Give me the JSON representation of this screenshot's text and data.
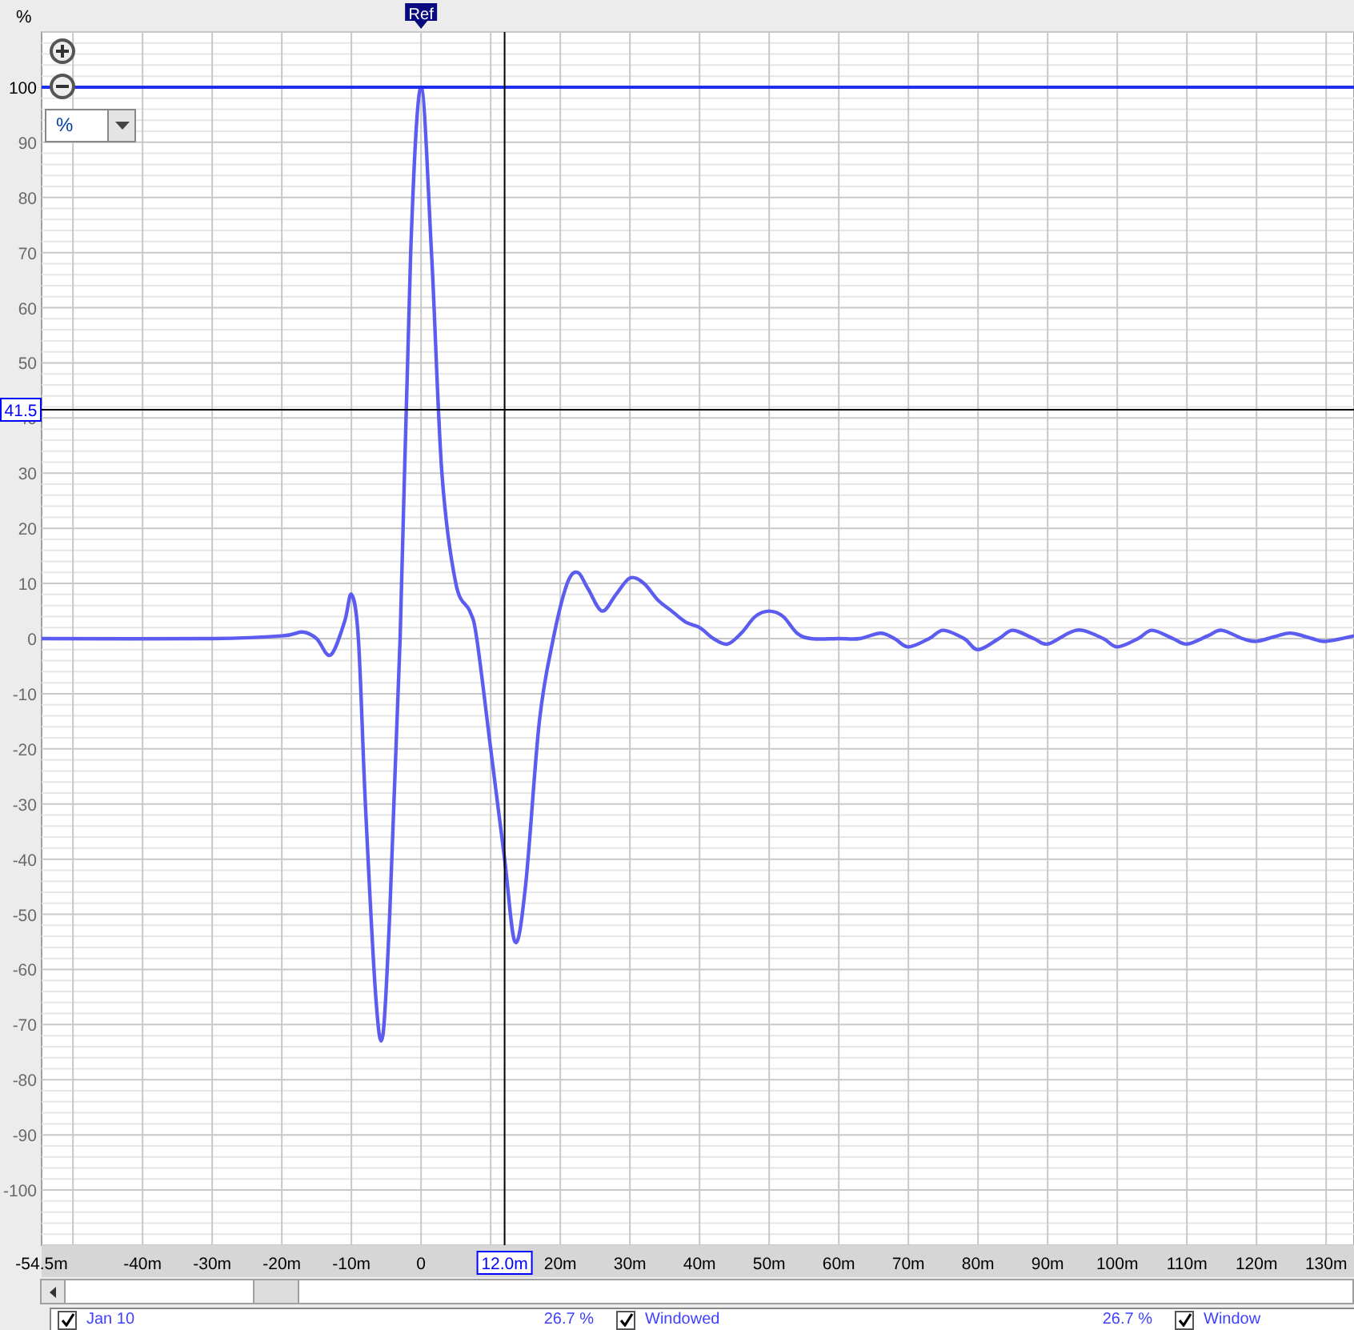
{
  "chart": {
    "units_select": {
      "value": "%"
    },
    "chart_data": {
      "type": "line",
      "ylabel": "%",
      "xlim": [
        -54.5,
        134
      ],
      "ylim": [
        -110,
        110
      ],
      "xticks": [
        {
          "value": -54.5,
          "label": "-54.5m"
        },
        {
          "value": -40,
          "label": "-40m"
        },
        {
          "value": -30,
          "label": "-30m"
        },
        {
          "value": -20,
          "label": "-20m"
        },
        {
          "value": -10,
          "label": "-10m"
        },
        {
          "value": 0,
          "label": "0"
        },
        {
          "value": 20,
          "label": "20m"
        },
        {
          "value": 30,
          "label": "30m"
        },
        {
          "value": 40,
          "label": "40m"
        },
        {
          "value": 50,
          "label": "50m"
        },
        {
          "value": 60,
          "label": "60m"
        },
        {
          "value": 70,
          "label": "70m"
        },
        {
          "value": 80,
          "label": "80m"
        },
        {
          "value": 90,
          "label": "90m"
        },
        {
          "value": 100,
          "label": "100m"
        },
        {
          "value": 110,
          "label": "110m"
        },
        {
          "value": 120,
          "label": "120m"
        },
        {
          "value": 130,
          "label": "130m"
        }
      ],
      "yticks": [
        100,
        90,
        80,
        70,
        60,
        50,
        40,
        30,
        20,
        10,
        0,
        -10,
        -20,
        -30,
        -40,
        -50,
        -60,
        -70,
        -80,
        -90,
        -100
      ],
      "x": [
        -54.5,
        -30,
        -20,
        -17,
        -15,
        -13,
        -11,
        -10,
        -9,
        -8,
        -6.5,
        -5.5,
        -4.5,
        -3,
        -1.5,
        0,
        1.5,
        3,
        5,
        7,
        8,
        10,
        12,
        13.5,
        15,
        17,
        19,
        21,
        22.5,
        24,
        26,
        28,
        30,
        32,
        34,
        36,
        38,
        40,
        42,
        44,
        46,
        48,
        50,
        52,
        54,
        56,
        60,
        63,
        66,
        68,
        70,
        73,
        75,
        78,
        80,
        83,
        85,
        88,
        90,
        93,
        95,
        98,
        100,
        103,
        105,
        108,
        110,
        113,
        115,
        118,
        120,
        123,
        125,
        128,
        130,
        134
      ],
      "series": [
        {
          "color": "#5c5cf0",
          "values": [
            0,
            0,
            0.5,
            1.2,
            0,
            -3,
            3,
            8,
            0,
            -30,
            -65,
            -72,
            -50,
            0,
            70,
            100,
            70,
            30,
            10,
            5,
            0,
            -20,
            -40,
            -55,
            -45,
            -15,
            0,
            10,
            12,
            9,
            5,
            8,
            11,
            10,
            7,
            5,
            3,
            2,
            0,
            -1,
            1,
            4,
            5,
            4,
            1,
            0,
            0,
            0,
            1,
            0,
            -1.5,
            0,
            1.5,
            0,
            -2,
            0,
            1.5,
            0,
            -1,
            1,
            1.5,
            0,
            -1.5,
            0,
            1.5,
            0,
            -1,
            0.5,
            1.5,
            0,
            -0.5,
            0.5,
            1,
            0,
            -0.5,
            0.5
          ]
        }
      ],
      "grid": true,
      "ref_lines": [
        {
          "axis": "y",
          "value": 100,
          "color": "#1f2ff0"
        },
        {
          "axis": "x",
          "value": 12,
          "label": "12.0m",
          "color": "#000000"
        },
        {
          "axis": "y",
          "value": 41.5,
          "label": "41.5",
          "color": "#000000"
        }
      ],
      "annotations": [
        {
          "text": "Ref",
          "x": 0
        }
      ]
    }
  },
  "legend": [
    {
      "checked": true,
      "label": "Jan 10",
      "value": "26.7 %"
    },
    {
      "checked": true,
      "label": "Windowed",
      "value": "26.7 %"
    },
    {
      "checked": true,
      "label": "Window"
    }
  ]
}
